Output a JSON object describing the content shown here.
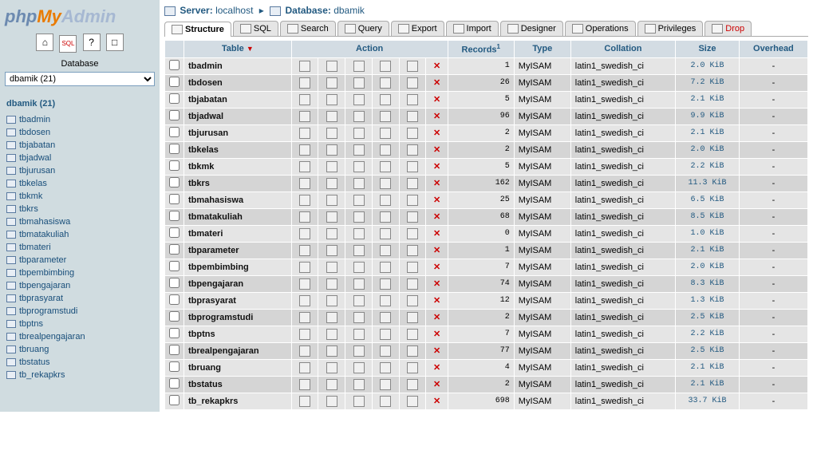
{
  "logo": {
    "p1": "php",
    "p2": "My",
    "p3": "Admin"
  },
  "sidebar": {
    "db_label": "Database",
    "db_select": "dbamik (21)",
    "db_name": "dbamik (21)",
    "tables": [
      "tbadmin",
      "tbdosen",
      "tbjabatan",
      "tbjadwal",
      "tbjurusan",
      "tbkelas",
      "tbkmk",
      "tbkrs",
      "tbmahasiswa",
      "tbmatakuliah",
      "tbmateri",
      "tbparameter",
      "tbpembimbing",
      "tbpengajaran",
      "tbprasyarat",
      "tbprogramstudi",
      "tbptns",
      "tbrealpengajaran",
      "tbruang",
      "tbstatus",
      "tb_rekapkrs"
    ]
  },
  "breadcrumb": {
    "server_label": "Server:",
    "server": "localhost",
    "db_label": "Database:",
    "db": "dbamik"
  },
  "tabs": {
    "structure": "Structure",
    "sql": "SQL",
    "search": "Search",
    "query": "Query",
    "export": "Export",
    "import": "Import",
    "designer": "Designer",
    "operations": "Operations",
    "privileges": "Privileges",
    "drop": "Drop"
  },
  "headers": {
    "table": "Table",
    "action": "Action",
    "records": "Records",
    "records_sup": "1",
    "type": "Type",
    "collation": "Collation",
    "size": "Size",
    "overhead": "Overhead"
  },
  "rows": [
    {
      "name": "tbadmin",
      "records": "1",
      "type": "MyISAM",
      "collation": "latin1_swedish_ci",
      "size": "2.0 KiB",
      "oh": "-"
    },
    {
      "name": "tbdosen",
      "records": "26",
      "type": "MyISAM",
      "collation": "latin1_swedish_ci",
      "size": "7.2 KiB",
      "oh": "-"
    },
    {
      "name": "tbjabatan",
      "records": "5",
      "type": "MyISAM",
      "collation": "latin1_swedish_ci",
      "size": "2.1 KiB",
      "oh": "-"
    },
    {
      "name": "tbjadwal",
      "records": "96",
      "type": "MyISAM",
      "collation": "latin1_swedish_ci",
      "size": "9.9 KiB",
      "oh": "-"
    },
    {
      "name": "tbjurusan",
      "records": "2",
      "type": "MyISAM",
      "collation": "latin1_swedish_ci",
      "size": "2.1 KiB",
      "oh": "-"
    },
    {
      "name": "tbkelas",
      "records": "2",
      "type": "MyISAM",
      "collation": "latin1_swedish_ci",
      "size": "2.0 KiB",
      "oh": "-"
    },
    {
      "name": "tbkmk",
      "records": "5",
      "type": "MyISAM",
      "collation": "latin1_swedish_ci",
      "size": "2.2 KiB",
      "oh": "-"
    },
    {
      "name": "tbkrs",
      "records": "162",
      "type": "MyISAM",
      "collation": "latin1_swedish_ci",
      "size": "11.3 KiB",
      "oh": "-"
    },
    {
      "name": "tbmahasiswa",
      "records": "25",
      "type": "MyISAM",
      "collation": "latin1_swedish_ci",
      "size": "6.5 KiB",
      "oh": "-"
    },
    {
      "name": "tbmatakuliah",
      "records": "68",
      "type": "MyISAM",
      "collation": "latin1_swedish_ci",
      "size": "8.5 KiB",
      "oh": "-"
    },
    {
      "name": "tbmateri",
      "records": "0",
      "type": "MyISAM",
      "collation": "latin1_swedish_ci",
      "size": "1.0 KiB",
      "oh": "-"
    },
    {
      "name": "tbparameter",
      "records": "1",
      "type": "MyISAM",
      "collation": "latin1_swedish_ci",
      "size": "2.1 KiB",
      "oh": "-"
    },
    {
      "name": "tbpembimbing",
      "records": "7",
      "type": "MyISAM",
      "collation": "latin1_swedish_ci",
      "size": "2.0 KiB",
      "oh": "-"
    },
    {
      "name": "tbpengajaran",
      "records": "74",
      "type": "MyISAM",
      "collation": "latin1_swedish_ci",
      "size": "8.3 KiB",
      "oh": "-"
    },
    {
      "name": "tbprasyarat",
      "records": "12",
      "type": "MyISAM",
      "collation": "latin1_swedish_ci",
      "size": "1.3 KiB",
      "oh": "-"
    },
    {
      "name": "tbprogramstudi",
      "records": "2",
      "type": "MyISAM",
      "collation": "latin1_swedish_ci",
      "size": "2.5 KiB",
      "oh": "-"
    },
    {
      "name": "tbptns",
      "records": "7",
      "type": "MyISAM",
      "collation": "latin1_swedish_ci",
      "size": "2.2 KiB",
      "oh": "-"
    },
    {
      "name": "tbrealpengajaran",
      "records": "77",
      "type": "MyISAM",
      "collation": "latin1_swedish_ci",
      "size": "2.5 KiB",
      "oh": "-"
    },
    {
      "name": "tbruang",
      "records": "4",
      "type": "MyISAM",
      "collation": "latin1_swedish_ci",
      "size": "2.1 KiB",
      "oh": "-"
    },
    {
      "name": "tbstatus",
      "records": "2",
      "type": "MyISAM",
      "collation": "latin1_swedish_ci",
      "size": "2.1 KiB",
      "oh": "-"
    },
    {
      "name": "tb_rekapkrs",
      "records": "698",
      "type": "MyISAM",
      "collation": "latin1_swedish_ci",
      "size": "33.7 KiB",
      "oh": "-"
    }
  ]
}
